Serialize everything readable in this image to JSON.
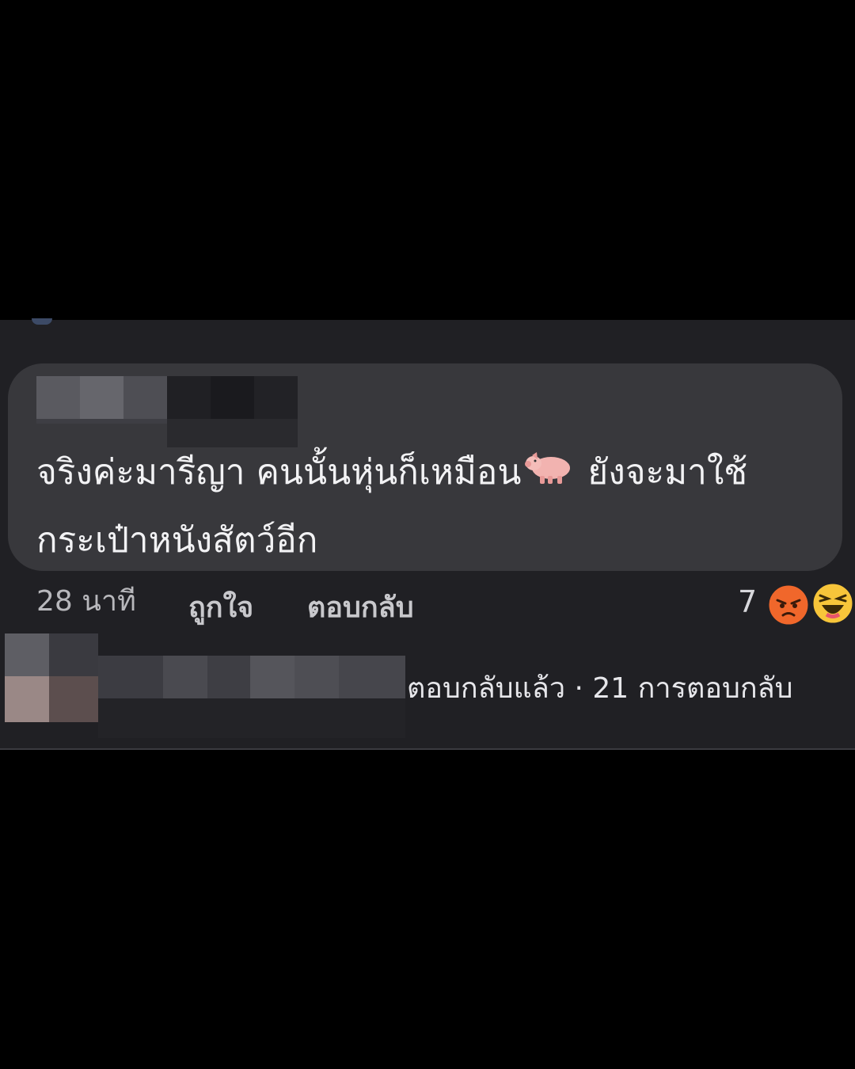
{
  "comment": {
    "text_line1": "จริงค่ะมารีญา คนนั้นหุ่นก็เหมือน",
    "text_line1_after_emoji": " ยังจะมาใช้",
    "text_line2": "กระเป๋าหนังสัตว์อีก",
    "inline_emoji": "pig-icon",
    "bubble_color": "#38383c",
    "text_color": "#f2f2f4"
  },
  "meta": {
    "time": "28 นาที",
    "like_label": "ถูกใจ",
    "reply_label": "ตอบกลับ",
    "reaction_count": "7",
    "reactions": [
      "angry-icon",
      "haha-icon"
    ]
  },
  "reply_summary": {
    "text": "ตอบกลับแล้ว · 21 การตอบกลับ"
  },
  "colors": {
    "background": "#000000",
    "panel": "#202024",
    "angry": "#f0672b",
    "haha": "#f7c53a"
  }
}
